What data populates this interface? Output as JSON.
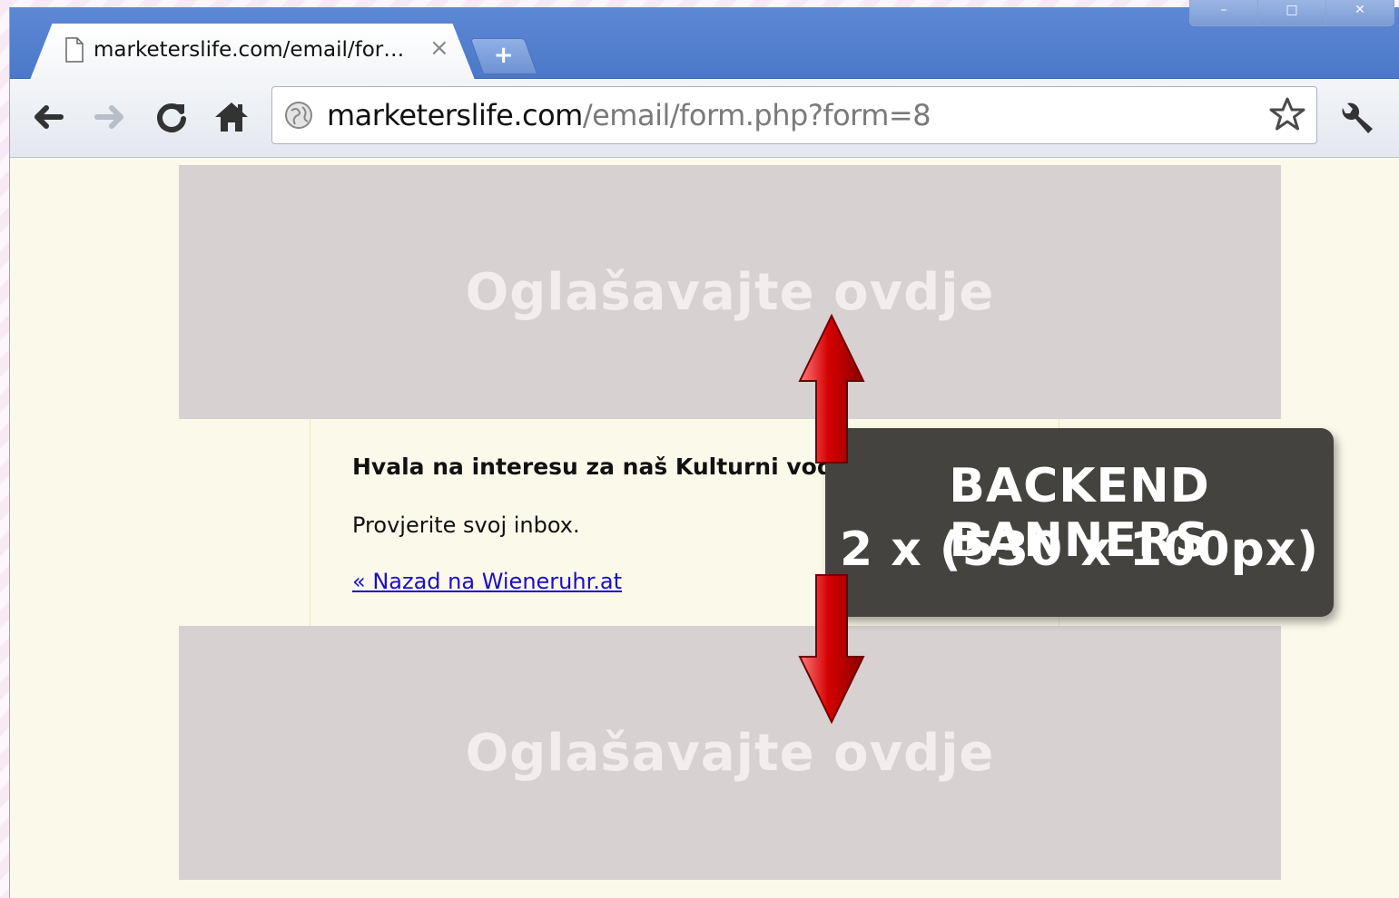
{
  "window": {
    "controls": [
      "–",
      "□",
      "✕"
    ]
  },
  "tab": {
    "title": "marketerslife.com/email/for…",
    "close": "×",
    "new_tab": "+"
  },
  "toolbar": {
    "url_domain": "marketerslife.com",
    "url_path": "/email/form.php?form=8"
  },
  "page": {
    "banner_top": "Oglašavajte ovdje",
    "banner_bottom": "Oglašavajte ovdje",
    "thanks": "Hvala na interesu za naš Kulturni vodič kroz Beč",
    "inbox": "Provjerite svoj inbox.",
    "back_link": "« Nazad na Wieneruhr.at"
  },
  "callout": {
    "line1": "BACKEND BANNERS",
    "line2": "2 x (530 x 100px)"
  },
  "colors": {
    "arrow": "#c40000",
    "banner_bg": "#d8d1d1",
    "page_bg": "#fbf9ea",
    "callout_bg": "#444340",
    "link": "#1a0dcc"
  }
}
